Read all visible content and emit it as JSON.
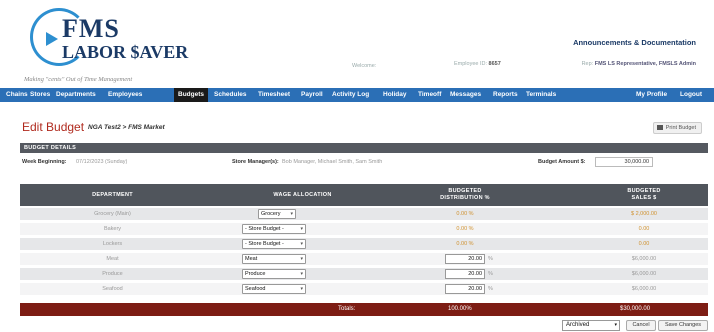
{
  "brand": {
    "line1": "FMS",
    "line2": "LABOR $AVER",
    "tagline": "Making \"cents\" Out of Time Management"
  },
  "header": {
    "announcements": "Announcements & Documentation",
    "welcome": "Welcome:",
    "employee_label": "Employee ID:",
    "employee_id": "8657",
    "rep_label": "Rep:",
    "rep_value": "FMS LS Representative, FMSLS Admin"
  },
  "nav": {
    "items": [
      "Chains",
      "Stores",
      "Departments",
      "Employees",
      "Budgets",
      "Schedules",
      "Timesheet",
      "Payroll",
      "Activity Log",
      "Holiday",
      "Timeoff",
      "Messages",
      "Reports",
      "Terminals"
    ],
    "active": "Budgets",
    "right": [
      "My Profile",
      "Logout"
    ]
  },
  "page": {
    "title": "Edit Budget",
    "crumb": "NGA Test2 > FMS Market",
    "print_label": "Print Budget"
  },
  "details": {
    "section_title": "BUDGET DETAILS",
    "week_label": "Week Beginning:",
    "week_value": "07/12/2023 (Sunday)",
    "managers_label": "Store Manager(s):",
    "managers_value": "Bob Manager, Michael Smith, Sam Smith",
    "amount_label": "Budget Amount $:",
    "amount_value": "30,000.00"
  },
  "table": {
    "columns": {
      "department": "DEPARTMENT",
      "wage": "WAGE ALLOCATION",
      "dist_line1": "BUDGETED",
      "dist_line2": "DISTRIBUTION %",
      "sales_line1": "BUDGETED",
      "sales_line2": "SALES $"
    },
    "rows": [
      {
        "department": "Grocery (Main)",
        "allocation": "Grocery",
        "distribution": "0.00",
        "sales": "$ 2,000.00",
        "editable": false
      },
      {
        "department": "Bakery",
        "allocation": "- Store Budget -",
        "distribution": "0.00",
        "sales": "0.00",
        "editable": false
      },
      {
        "department": "Lockers",
        "allocation": "- Store Budget -",
        "distribution": "0.00",
        "sales": "0.00",
        "editable": false
      },
      {
        "department": "Meat",
        "allocation": "Meat",
        "distribution": "20.00",
        "sales": "$6,000.00",
        "editable": true
      },
      {
        "department": "Produce",
        "allocation": "Produce",
        "distribution": "20.00",
        "sales": "$6,000.00",
        "editable": true
      },
      {
        "department": "Seafood",
        "allocation": "Seafood",
        "distribution": "20.00",
        "sales": "$6,000.00",
        "editable": true
      }
    ],
    "pct_sign": "%",
    "totals_label": "Totals:",
    "totals_distribution": "100.00%",
    "totals_sales": "$30,000.00"
  },
  "footer": {
    "status_value": "Archived",
    "cancel_label": "Cancel",
    "save_label": "Save Changes"
  },
  "colors": {
    "nav": "#2b6fb6",
    "title": "#b02a1e",
    "totals_bar": "#7d1d14",
    "header_bar": "#50555c"
  }
}
